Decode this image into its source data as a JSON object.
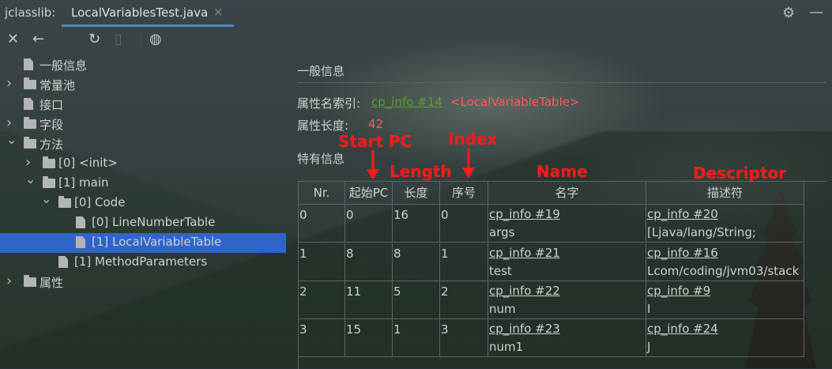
{
  "titlebar": {
    "app_name": "jclasslib:",
    "tab_label": "LocalVariablesTest.java",
    "tab_close": "×"
  },
  "tree": {
    "items": [
      {
        "label": "一般信息",
        "type": "file",
        "depth": 0,
        "expanded": null
      },
      {
        "label": "常量池",
        "type": "folder",
        "depth": 0,
        "expanded": false
      },
      {
        "label": "接口",
        "type": "file",
        "depth": 0,
        "expanded": null
      },
      {
        "label": "字段",
        "type": "folder",
        "depth": 0,
        "expanded": false
      },
      {
        "label": "方法",
        "type": "folder",
        "depth": 0,
        "expanded": true
      },
      {
        "label": "[0] <init>",
        "type": "folder",
        "depth": 1,
        "expanded": false
      },
      {
        "label": "[1] main",
        "type": "folder",
        "depth": 1,
        "expanded": true
      },
      {
        "label": "[0] Code",
        "type": "folder",
        "depth": 2,
        "expanded": true
      },
      {
        "label": "[0] LineNumberTable",
        "type": "file",
        "depth": 3,
        "expanded": null
      },
      {
        "label": "[1] LocalVariableTable",
        "type": "file",
        "depth": 3,
        "expanded": null,
        "selected": true
      },
      {
        "label": "[1] MethodParameters",
        "type": "file",
        "depth": 2,
        "expanded": null
      },
      {
        "label": "属性",
        "type": "folder",
        "depth": 0,
        "expanded": false
      }
    ]
  },
  "panel": {
    "section_general": "一般信息",
    "attr_name_index_label": "属性名索引:",
    "attr_name_index_link": "cp_info #14",
    "attr_name_index_value": "<LocalVariableTable>",
    "attr_length_label": "属性长度:",
    "attr_length_value": "42",
    "section_specific": "特有信息"
  },
  "annotations": {
    "start_pc": "Start PC",
    "index": "Index",
    "length": "Length",
    "name": "Name",
    "descriptor": "Descriptor",
    "color": "#ff1b1b"
  },
  "table": {
    "headers": [
      "Nr.",
      "起始PC",
      "长度",
      "序号",
      "名字",
      "描述符"
    ],
    "rows": [
      {
        "nr": "0",
        "start_pc": "0",
        "length": "16",
        "index": "0",
        "name_link": "cp_info #19",
        "name_value": "args",
        "desc_link": "cp_info #20",
        "desc_value": "[Ljava/lang/String;"
      },
      {
        "nr": "1",
        "start_pc": "8",
        "length": "8",
        "index": "1",
        "name_link": "cp_info #21",
        "name_value": "test",
        "desc_link": "cp_info #16",
        "desc_value": "Lcom/coding/jvm03/stack"
      },
      {
        "nr": "2",
        "start_pc": "11",
        "length": "5",
        "index": "2",
        "name_link": "cp_info #22",
        "name_value": "num",
        "desc_link": "cp_info #9",
        "desc_value": "I"
      },
      {
        "nr": "3",
        "start_pc": "15",
        "length": "1",
        "index": "3",
        "name_link": "cp_info #23",
        "name_value": "num1",
        "desc_link": "cp_info #24",
        "desc_value": "J"
      }
    ]
  },
  "colors": {
    "accent": "#4a88c7",
    "selection": "#2f65ca",
    "link": "#5aa02c",
    "value_red": "#ff5a5a"
  }
}
